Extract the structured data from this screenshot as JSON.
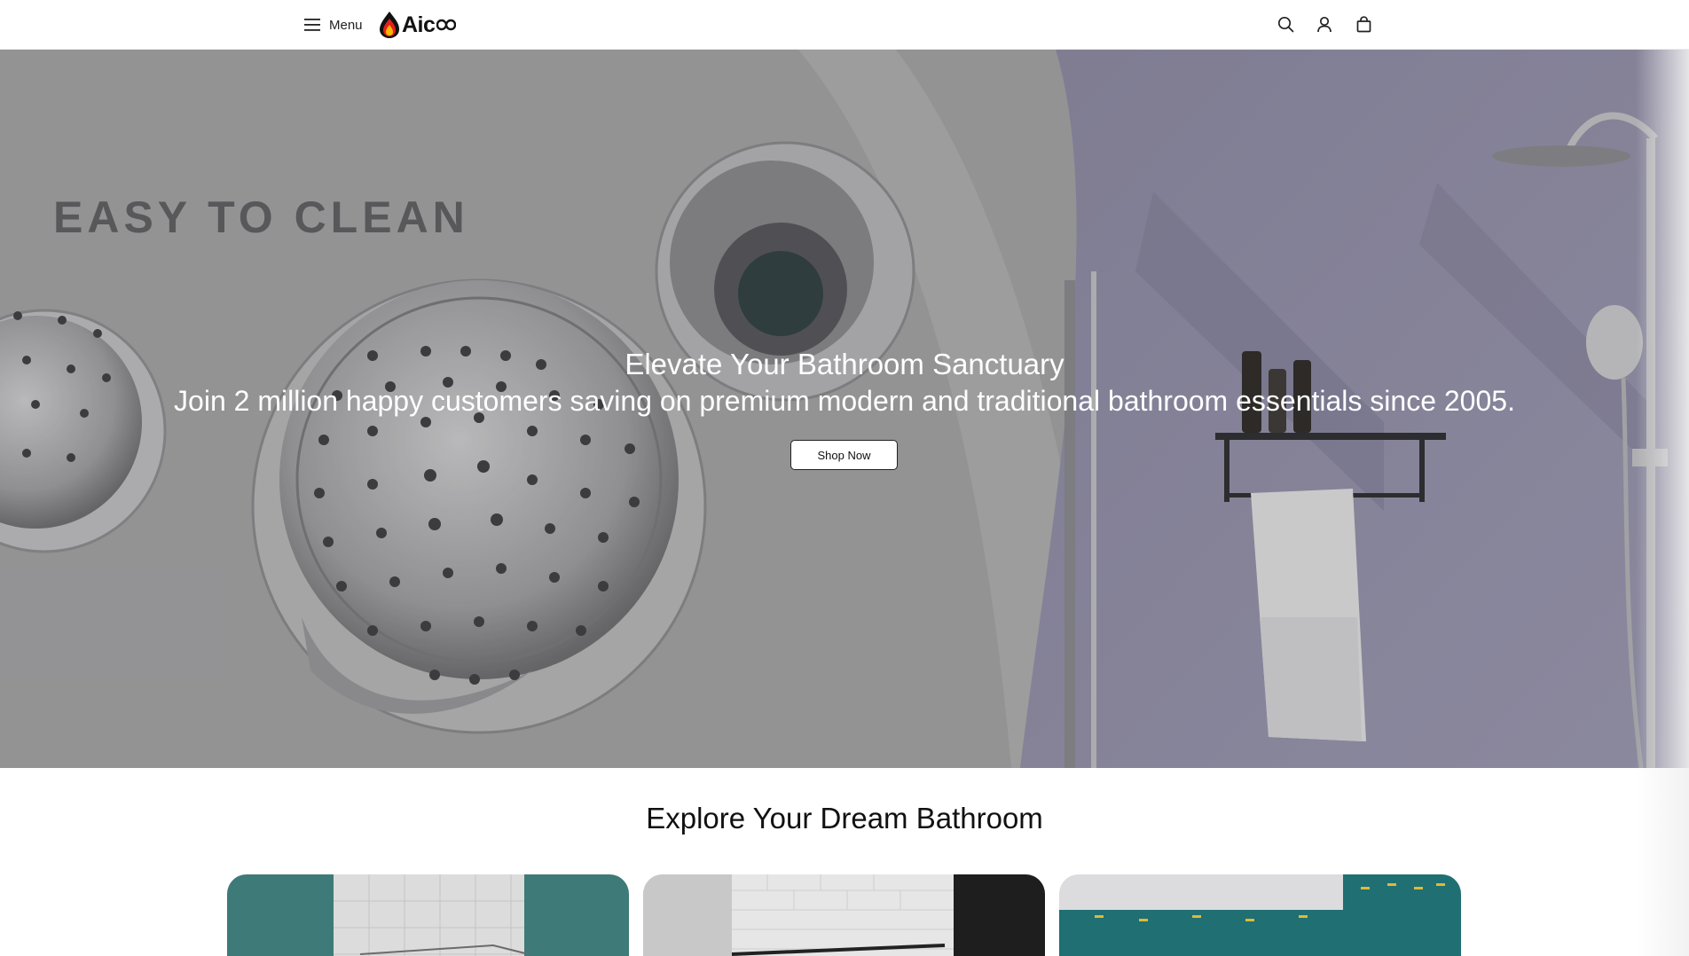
{
  "header": {
    "menu_label": "Menu",
    "logo_text": "Aic",
    "icons": [
      "search-icon",
      "account-icon",
      "cart-icon"
    ]
  },
  "hero": {
    "background_text": "EASY TO CLEAN",
    "title": "Elevate Your Bathroom Sanctuary",
    "subtitle": "Join 2 million happy customers saving on premium modern and traditional bathroom essentials since 2005.",
    "cta_label": "Shop Now"
  },
  "section": {
    "title": "Explore Your Dream Bathroom",
    "cards": [
      {
        "name": "shower-enclosure-card",
        "accent": "#3d7a78"
      },
      {
        "name": "black-frame-shower-card",
        "accent": "#1e1e1e"
      },
      {
        "name": "teal-tiled-bathroom-card",
        "accent": "#1f6f73"
      }
    ]
  },
  "colors": {
    "header_bg": "#ffffff",
    "hero_bg": "#a9a9ab",
    "text_primary": "#111111",
    "button_bg": "#ffffff"
  }
}
